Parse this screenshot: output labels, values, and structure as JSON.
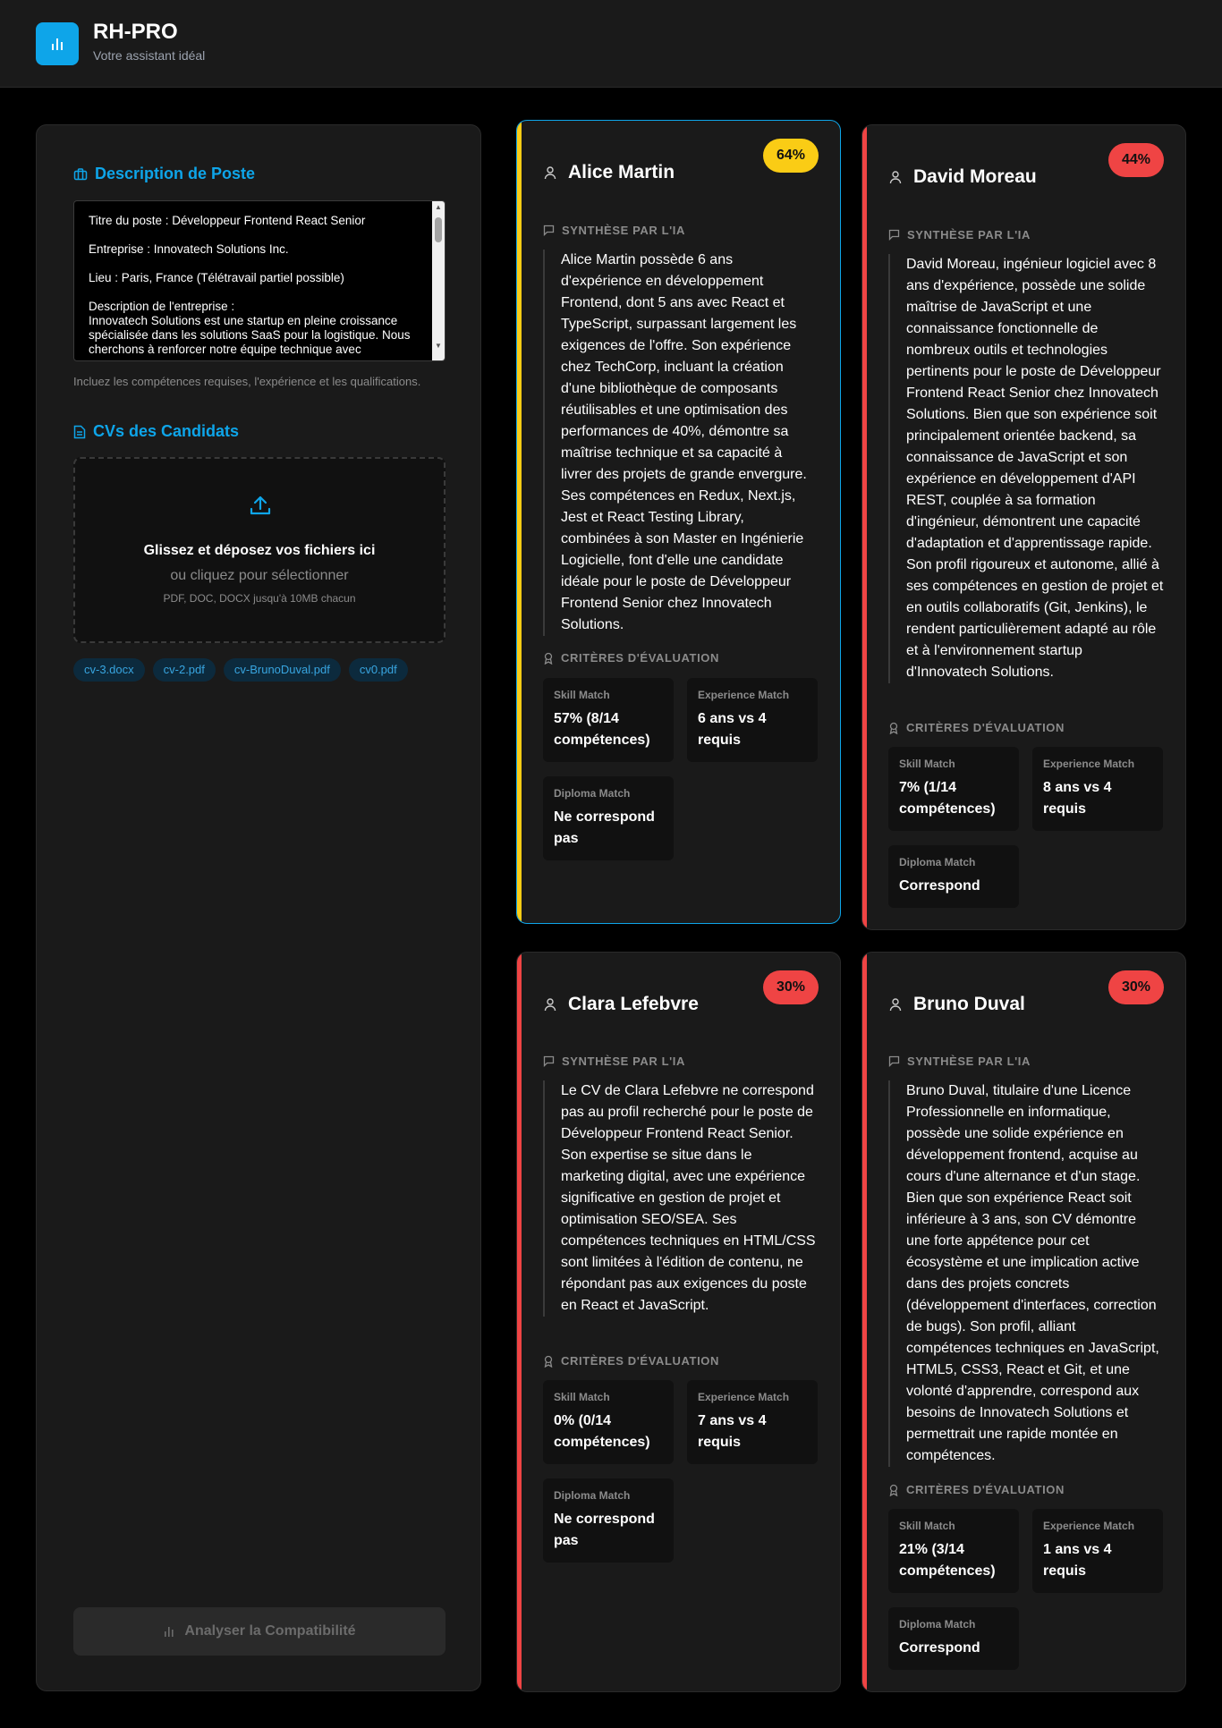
{
  "app": {
    "title": "RH-PRO",
    "subtitle": "Votre assistant idéal",
    "icon": "bar-chart-icon"
  },
  "left": {
    "job_section_title": "Description de Poste",
    "job_text": "Titre du poste : Développeur Frontend React Senior\n\nEntreprise : Innovatech Solutions Inc.\n\nLieu : Paris, France (Télétravail partiel possible)\n\nDescription de l'entreprise :\nInnovatech Solutions est une startup en pleine croissance spécialisée dans les solutions SaaS pour la logistique. Nous cherchons à renforcer notre équipe technique avec",
    "hint": "Incluez les compétences requises, l'expérience et les qualifications.",
    "cv_section_title": "CVs des Candidats",
    "drop_title": "Glissez et déposez vos fichiers ici",
    "drop_sub": "ou cliquez pour sélectionner",
    "drop_small": "PDF, DOC, DOCX jusqu'à 10MB chacun",
    "files": [
      "cv-3.docx",
      "cv-2.pdf",
      "cv-BrunoDuval.pdf",
      "cv0.pdf"
    ],
    "analyze_label": "Analyser la Compatibilité"
  },
  "labels": {
    "summary": "SYNTHÈSE PAR L'IA",
    "criteria": "CRITÈRES D'ÉVALUATION",
    "skill": "Skill Match",
    "experience": "Experience Match",
    "diploma": "Diploma Match"
  },
  "colors": {
    "accent": "#0ea5e9",
    "high": "#facc15",
    "low": "#ef4444"
  },
  "candidates": [
    {
      "name": "Alice Martin",
      "score": "64%",
      "summary": "Alice Martin possède 6 ans d'expérience en développement Frontend, dont 5 ans avec React et TypeScript, surpassant largement les exigences de l'offre. Son expérience chez TechCorp, incluant la création d'une bibliothèque de composants réutilisables et une optimisation des performances de 40%, démontre sa maîtrise technique et sa capacité à livrer des projets de grande envergure. Ses compétences en Redux, Next.js, Jest et React Testing Library, combinées à son Master en Ingénierie Logicielle, font d'elle une candidate idéale pour le poste de Développeur Frontend Senior chez Innovatech Solutions.",
      "skill": "57% (8/14 compétences)",
      "experience": "6 ans vs 4 requis",
      "diploma": "Ne correspond pas"
    },
    {
      "name": "David Moreau",
      "score": "44%",
      "summary": "David Moreau, ingénieur logiciel avec 8 ans d'expérience, possède une solide maîtrise de JavaScript et une connaissance fonctionnelle de nombreux outils et technologies pertinents pour le poste de Développeur Frontend React Senior chez Innovatech Solutions. Bien que son expérience soit principalement orientée backend, sa connaissance de JavaScript et son expérience en développement d'API REST, couplée à sa formation d'ingénieur, démontrent une capacité d'adaptation et d'apprentissage rapide. Son profil rigoureux et autonome, allié à ses compétences en gestion de projet et en outils collaboratifs (Git, Jenkins), le rendent particulièrement adapté au rôle et à l'environnement startup d'Innovatech Solutions.",
      "skill": "7% (1/14 compétences)",
      "experience": "8 ans vs 4 requis",
      "diploma": "Correspond"
    },
    {
      "name": "Clara Lefebvre",
      "score": "30%",
      "summary": "Le CV de Clara Lefebvre ne correspond pas au profil recherché pour le poste de Développeur Frontend React Senior. Son expertise se situe dans le marketing digital, avec une expérience significative en gestion de projet et optimisation SEO/SEA. Ses compétences techniques en HTML/CSS sont limitées à l'édition de contenu, ne répondant pas aux exigences du poste en React et JavaScript.",
      "skill": "0% (0/14 compétences)",
      "experience": "7 ans vs 4 requis",
      "diploma": "Ne correspond pas"
    },
    {
      "name": "Bruno Duval",
      "score": "30%",
      "summary": "Bruno Duval, titulaire d'une Licence Professionnelle en informatique, possède une solide expérience en développement frontend, acquise au cours d'une alternance et d'un stage. Bien que son expérience React soit inférieure à 3 ans, son CV démontre une forte appétence pour cet écosystème et une implication active dans des projets concrets (développement d'interfaces, correction de bugs). Son profil, alliant compétences techniques en JavaScript, HTML5, CSS3, React et Git, et une volonté d'apprendre, correspond aux besoins de Innovatech Solutions et permettrait une rapide montée en compétences.",
      "skill": "21% (3/14 compétences)",
      "experience": "1 ans vs 4 requis",
      "diploma": "Correspond"
    }
  ]
}
